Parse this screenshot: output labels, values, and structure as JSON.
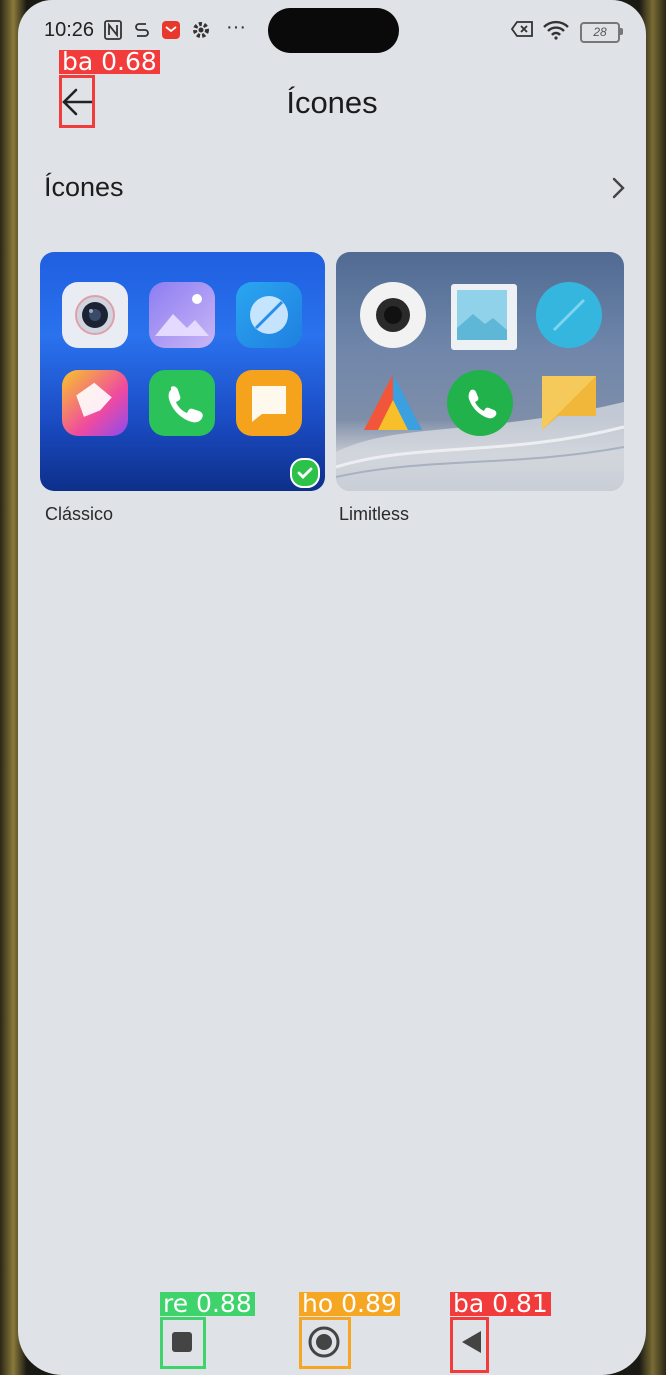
{
  "status_bar": {
    "time": "10:26",
    "battery": "28",
    "left_icons": [
      "nfc-icon",
      "sync-icon",
      "mail-app-icon",
      "gear-icon",
      "more-icon"
    ],
    "right_icons": [
      "data-off-icon",
      "wifi-icon",
      "battery-icon"
    ]
  },
  "header": {
    "title": "Ícones",
    "back_icon": "arrow-left-icon"
  },
  "section": {
    "title": "Ícones",
    "chevron_icon": "chevron-right-icon"
  },
  "themes": [
    {
      "label": "Clássico",
      "selected": true,
      "icons": [
        "camera-icon",
        "gallery-icon",
        "browser-icon",
        "themes-icon",
        "phone-icon",
        "messages-icon"
      ]
    },
    {
      "label": "Limitless",
      "selected": false,
      "icons": [
        "camera-icon",
        "gallery-icon",
        "browser-icon",
        "themes-icon",
        "phone-icon",
        "messages-icon"
      ]
    }
  ],
  "nav_bar": {
    "recents": "recents-icon",
    "home": "home-icon",
    "back": "back-triangle-icon"
  },
  "detections": [
    {
      "label": "ba 0.68",
      "color": "#f23b3b"
    },
    {
      "label": "re 0.88",
      "color": "#3fd36b"
    },
    {
      "label": "ho 0.89",
      "color": "#f5a623"
    },
    {
      "label": "ba 0.81",
      "color": "#f23b3b"
    }
  ]
}
